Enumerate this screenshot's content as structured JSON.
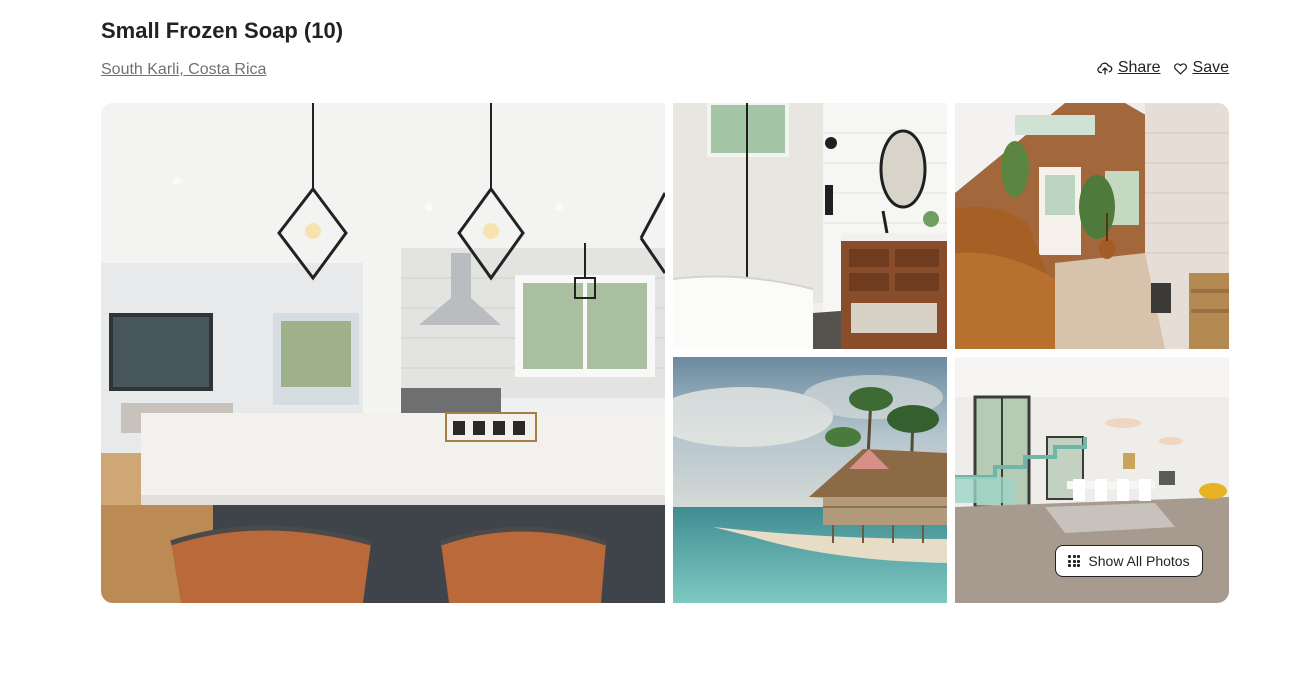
{
  "listing": {
    "title": "Small Frozen Soap (10)",
    "location": "South Karli, Costa Rica"
  },
  "actions": {
    "share_label": "Share",
    "save_label": "Save",
    "share_icon": "cloud-upload-icon",
    "save_icon": "heart-icon"
  },
  "gallery": {
    "photos": [
      {
        "subject": "kitchen-living-room"
      },
      {
        "subject": "bathroom"
      },
      {
        "subject": "cabin-interior"
      },
      {
        "subject": "beach-bungalow"
      },
      {
        "subject": "modern-interior-staircase"
      }
    ],
    "show_all_label": "Show All Photos",
    "show_all_icon": "grid-dots-icon"
  }
}
